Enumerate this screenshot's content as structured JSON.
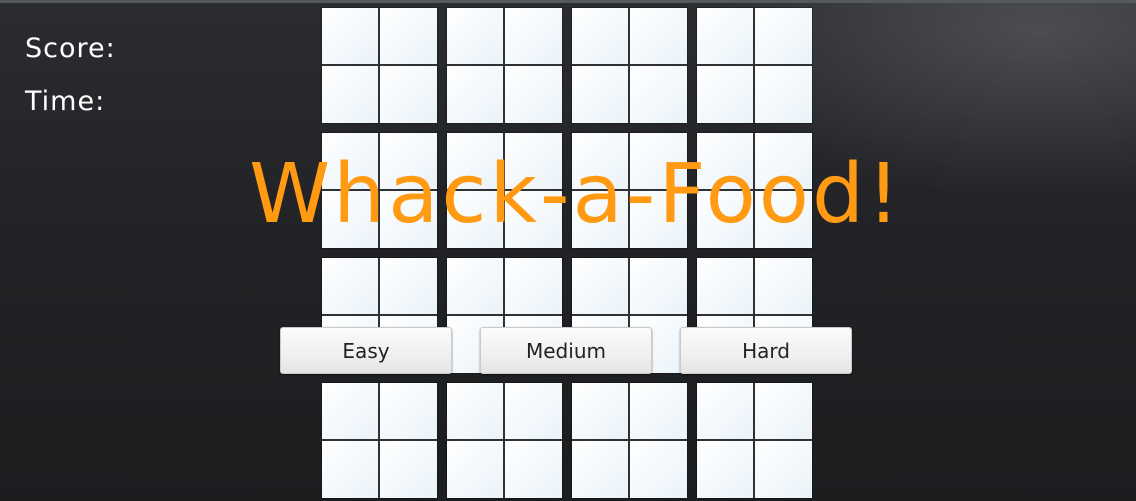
{
  "hud": {
    "score_label": "Score:",
    "time_label": "Time:"
  },
  "title": "Whack-a-Food!",
  "difficulty": {
    "easy_label": "Easy",
    "medium_label": "Medium",
    "hard_label": "Hard"
  },
  "board": {
    "rows": 4,
    "columns": 4,
    "cell_color": "#f3f8fb"
  },
  "colors": {
    "title": "#ff9a12",
    "background": "#222326",
    "hud_text": "#ffffff"
  }
}
